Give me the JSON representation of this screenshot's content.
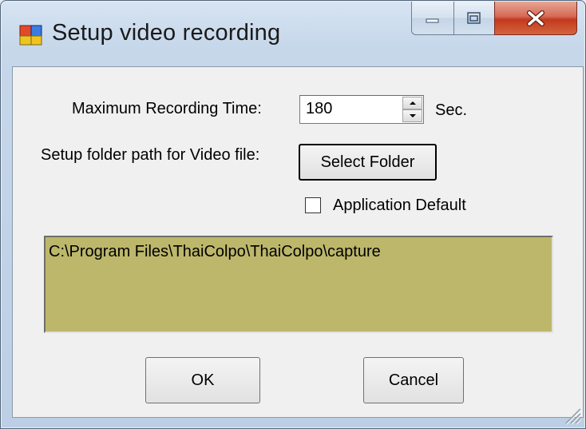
{
  "window": {
    "title": "Setup video recording"
  },
  "titlebar": {
    "minimize_icon": "minimize-icon",
    "maximize_icon": "maximize-icon",
    "close_icon": "close-icon"
  },
  "form": {
    "max_time_label": "Maximum Recording Time:",
    "max_time_value": "180",
    "unit_label": "Sec.",
    "folder_label": "Setup folder path for Video file:",
    "select_folder_label": "Select Folder",
    "app_default_label": "Application Default",
    "app_default_checked": false,
    "path_value": "C:\\Program Files\\ThaiColpo\\ThaiColpo\\capture",
    "path_bg_color": "#bdb76b"
  },
  "buttons": {
    "ok_label": "OK",
    "cancel_label": "Cancel"
  }
}
